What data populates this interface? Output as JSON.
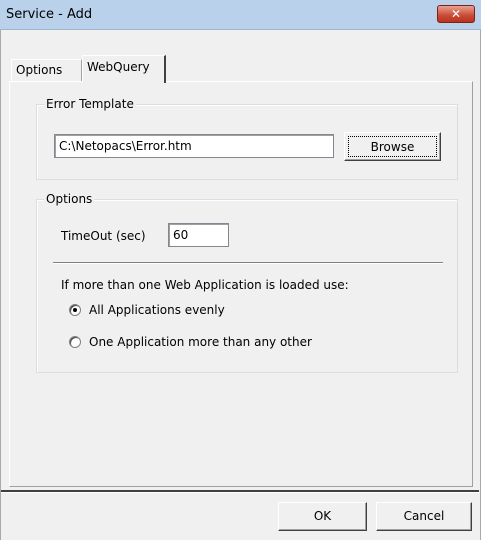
{
  "window": {
    "title": "Service - Add",
    "close_icon": "close-icon"
  },
  "tabs": [
    {
      "label": "Options",
      "selected": false
    },
    {
      "label": "WebQuery",
      "selected": true
    }
  ],
  "error_template": {
    "legend": "Error Template",
    "path_value": "C:\\Netopacs\\Error.htm",
    "browse_label": "Browse"
  },
  "options_group": {
    "legend": "Options",
    "timeout_label": "TimeOut (sec)",
    "timeout_value": "60",
    "load_balance_label": "If more than one Web Application is loaded use:",
    "radio_evenly_label": "All Applications evenly",
    "radio_more_label": "One Application more than any other",
    "selected_option": "evenly"
  },
  "footer": {
    "ok_label": "OK",
    "cancel_label": "Cancel"
  },
  "colors": {
    "close_button": "#c94a35",
    "titlebar": "#b9d1ea",
    "dialog_bg": "#f0f0f0"
  }
}
